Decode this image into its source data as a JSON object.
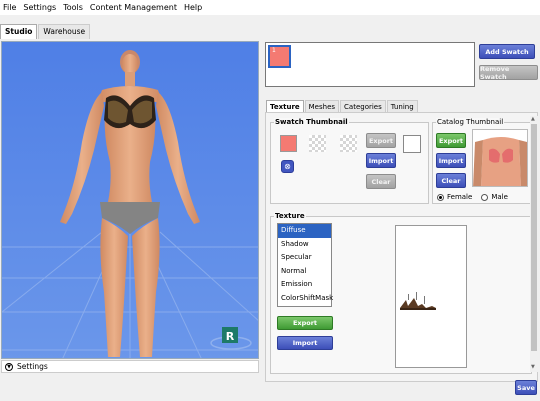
{
  "menu": [
    "File",
    "Settings",
    "Tools",
    "Content Management",
    "Help"
  ],
  "main_tabs": [
    "Studio",
    "Warehouse"
  ],
  "viewport": {
    "settings_label": "Settings",
    "gizmo_letter": "R"
  },
  "swatch": {
    "index_label": "1",
    "color": "#f47a72"
  },
  "buttons": {
    "add_swatch": "Add Swatch",
    "remove_swatch": "Remove Swatch",
    "save": "Save"
  },
  "inner_tabs": [
    "Texture",
    "Meshes",
    "Categories",
    "Tuning"
  ],
  "swatch_thumbnail": {
    "title": "Swatch Thumbnail",
    "export": "Export",
    "import": "Import",
    "clear": "Clear"
  },
  "catalog_thumbnail": {
    "title": "Catalog Thumbnail",
    "export": "Export",
    "import": "Import",
    "clear": "Clear",
    "gender_options": [
      "Female",
      "Male"
    ],
    "selected_gender": "Female"
  },
  "texture": {
    "title": "Texture",
    "items": [
      "Diffuse",
      "Shadow",
      "Specular",
      "Normal",
      "Emission",
      "ColorShiftMask"
    ],
    "selected": "Diffuse",
    "export": "Export",
    "import": "Import"
  },
  "icons": [
    "chevron-down-icon",
    "close-icon",
    "scroll-up-icon",
    "scroll-down-icon"
  ]
}
